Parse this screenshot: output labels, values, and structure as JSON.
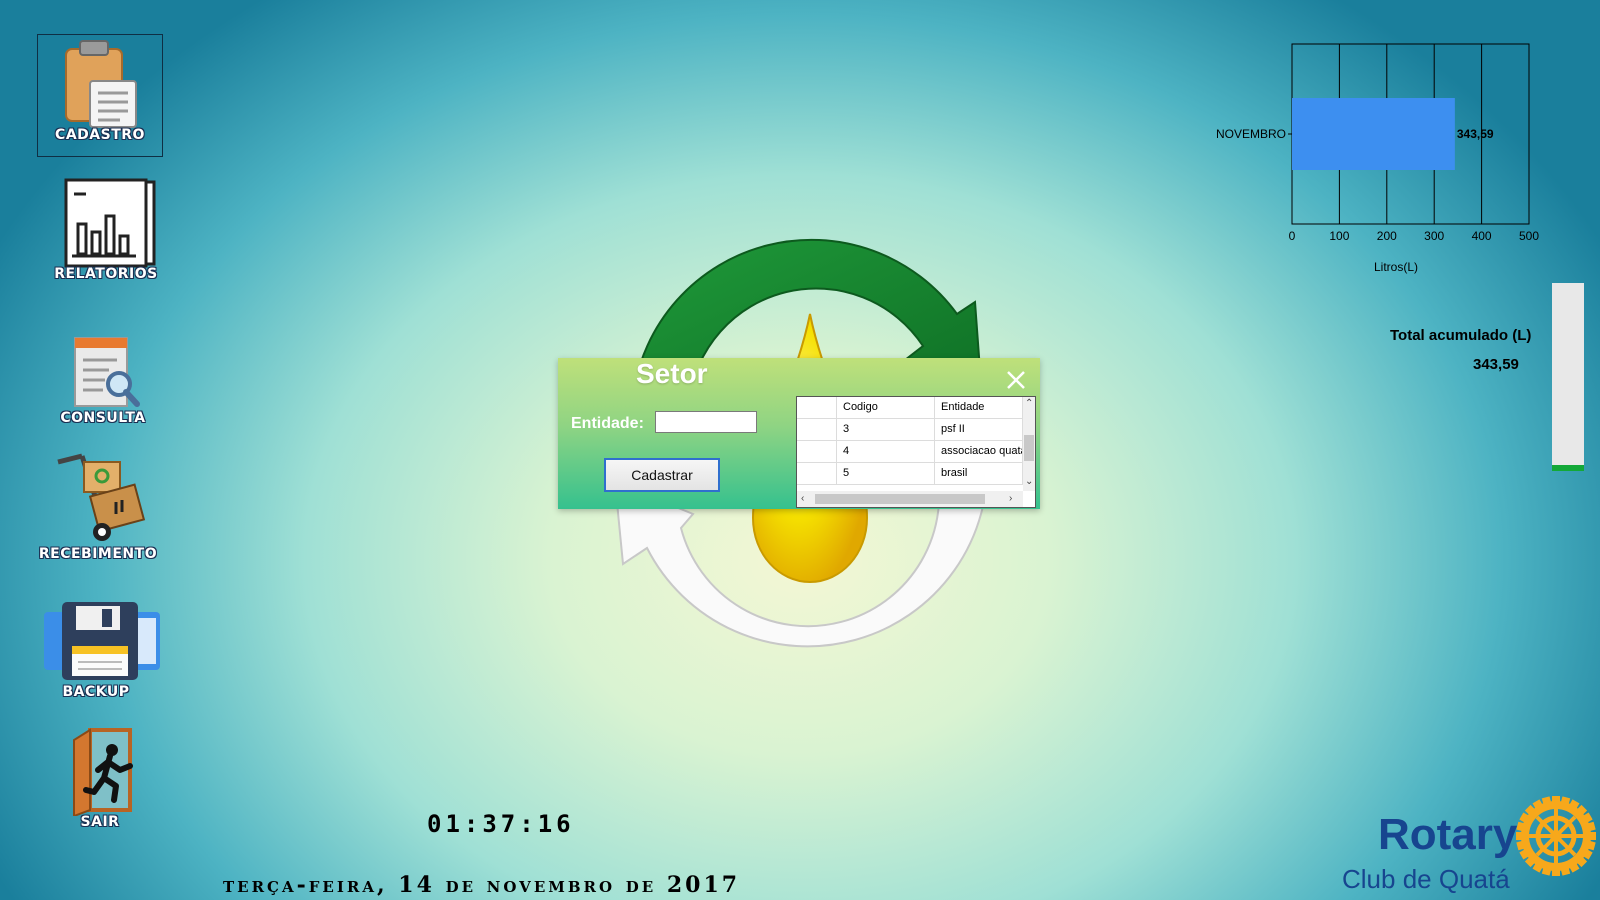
{
  "menu": {
    "items": [
      {
        "label": "CADASTRO",
        "icon": "clipboard-icon",
        "selected": true
      },
      {
        "label": "RELATORIOS",
        "icon": "report-chart-icon"
      },
      {
        "label": "CONSULTA",
        "icon": "document-search-icon"
      },
      {
        "label": "RECEBIMENTO",
        "icon": "hand-truck-icon"
      },
      {
        "label": "BACKUP",
        "icon": "floppy-disk-icon"
      },
      {
        "label": "SAIR",
        "icon": "exit-door-icon"
      }
    ]
  },
  "dialog": {
    "title": "Setor",
    "entidade_label": "Entidade:",
    "entidade_value": "",
    "submit_label": "Cadastrar",
    "grid": {
      "columns": [
        "",
        "Codigo",
        "Entidade"
      ],
      "rows": [
        {
          "codigo": "3",
          "entidade": "psf II"
        },
        {
          "codigo": "4",
          "entidade": "associacao quata"
        },
        {
          "codigo": "5",
          "entidade": "brasil"
        }
      ]
    }
  },
  "chart_data": {
    "type": "bar",
    "orientation": "horizontal",
    "categories": [
      "NOVEMBRO"
    ],
    "values": [
      343.59
    ],
    "data_labels": [
      "343,59"
    ],
    "xlabel": "Litros(L)",
    "xlim": [
      0,
      500
    ],
    "xticks": [
      "0",
      "100",
      "200",
      "300",
      "400",
      "500"
    ],
    "grid": true,
    "bar_color": "#3d8ff0"
  },
  "totals": {
    "label": "Total acumulado (L)",
    "value": "343,59",
    "level_fraction": 0.03,
    "level_color": "#13a838"
  },
  "clock": {
    "time": "01:37:16",
    "date": "terça-feira, 14 de novembro de 2017"
  },
  "brand": {
    "word": "Rotary",
    "club": "Club de Quatá",
    "color": "#17458f",
    "wheel_color": "#f7a81b"
  }
}
